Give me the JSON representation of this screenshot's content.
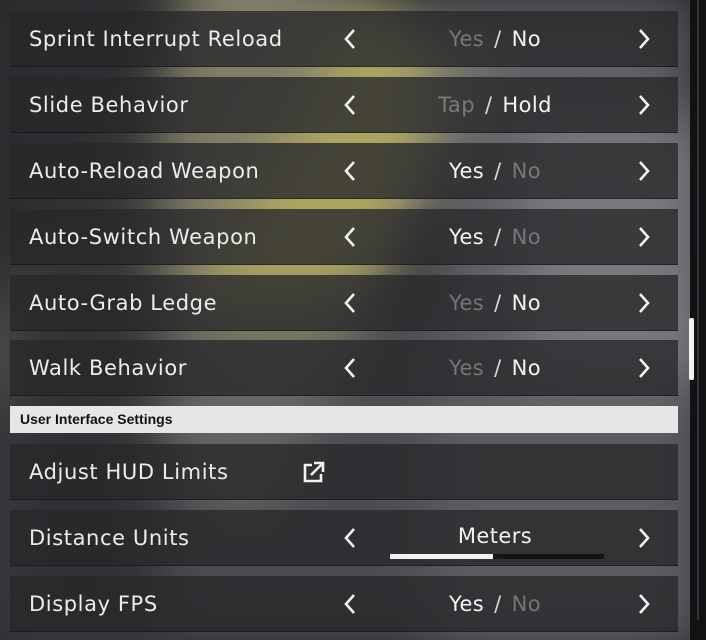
{
  "header": {
    "section_title": "User Interface Settings"
  },
  "rows_top": [
    {
      "label": "Sprint Interrupt Reload",
      "option_a": "Yes",
      "option_b": "No",
      "selected": "b"
    },
    {
      "label": "Slide Behavior",
      "option_a": "Tap",
      "option_b": "Hold",
      "selected": "b"
    },
    {
      "label": "Auto-Reload Weapon",
      "option_a": "Yes",
      "option_b": "No",
      "selected": "a"
    },
    {
      "label": "Auto-Switch Weapon",
      "option_a": "Yes",
      "option_b": "No",
      "selected": "a"
    },
    {
      "label": "Auto-Grab Ledge",
      "option_a": "Yes",
      "option_b": "No",
      "selected": "b"
    },
    {
      "label": "Walk Behavior",
      "option_a": "Yes",
      "option_b": "No",
      "selected": "b"
    }
  ],
  "hud_limits": {
    "label": "Adjust HUD Limits",
    "icon": "external-link-icon"
  },
  "distance_units": {
    "label": "Distance Units",
    "value": "Meters",
    "position": 0.5
  },
  "display_fps": {
    "label": "Display FPS",
    "option_a": "Yes",
    "option_b": "No",
    "selected": "a"
  },
  "separator": "/",
  "icons": {
    "prev": "chevron-left-icon",
    "next": "chevron-right-icon"
  },
  "colors": {
    "section_header_bg": "#e6e6e6",
    "scroll_thumb": "#f3f3f3"
  }
}
